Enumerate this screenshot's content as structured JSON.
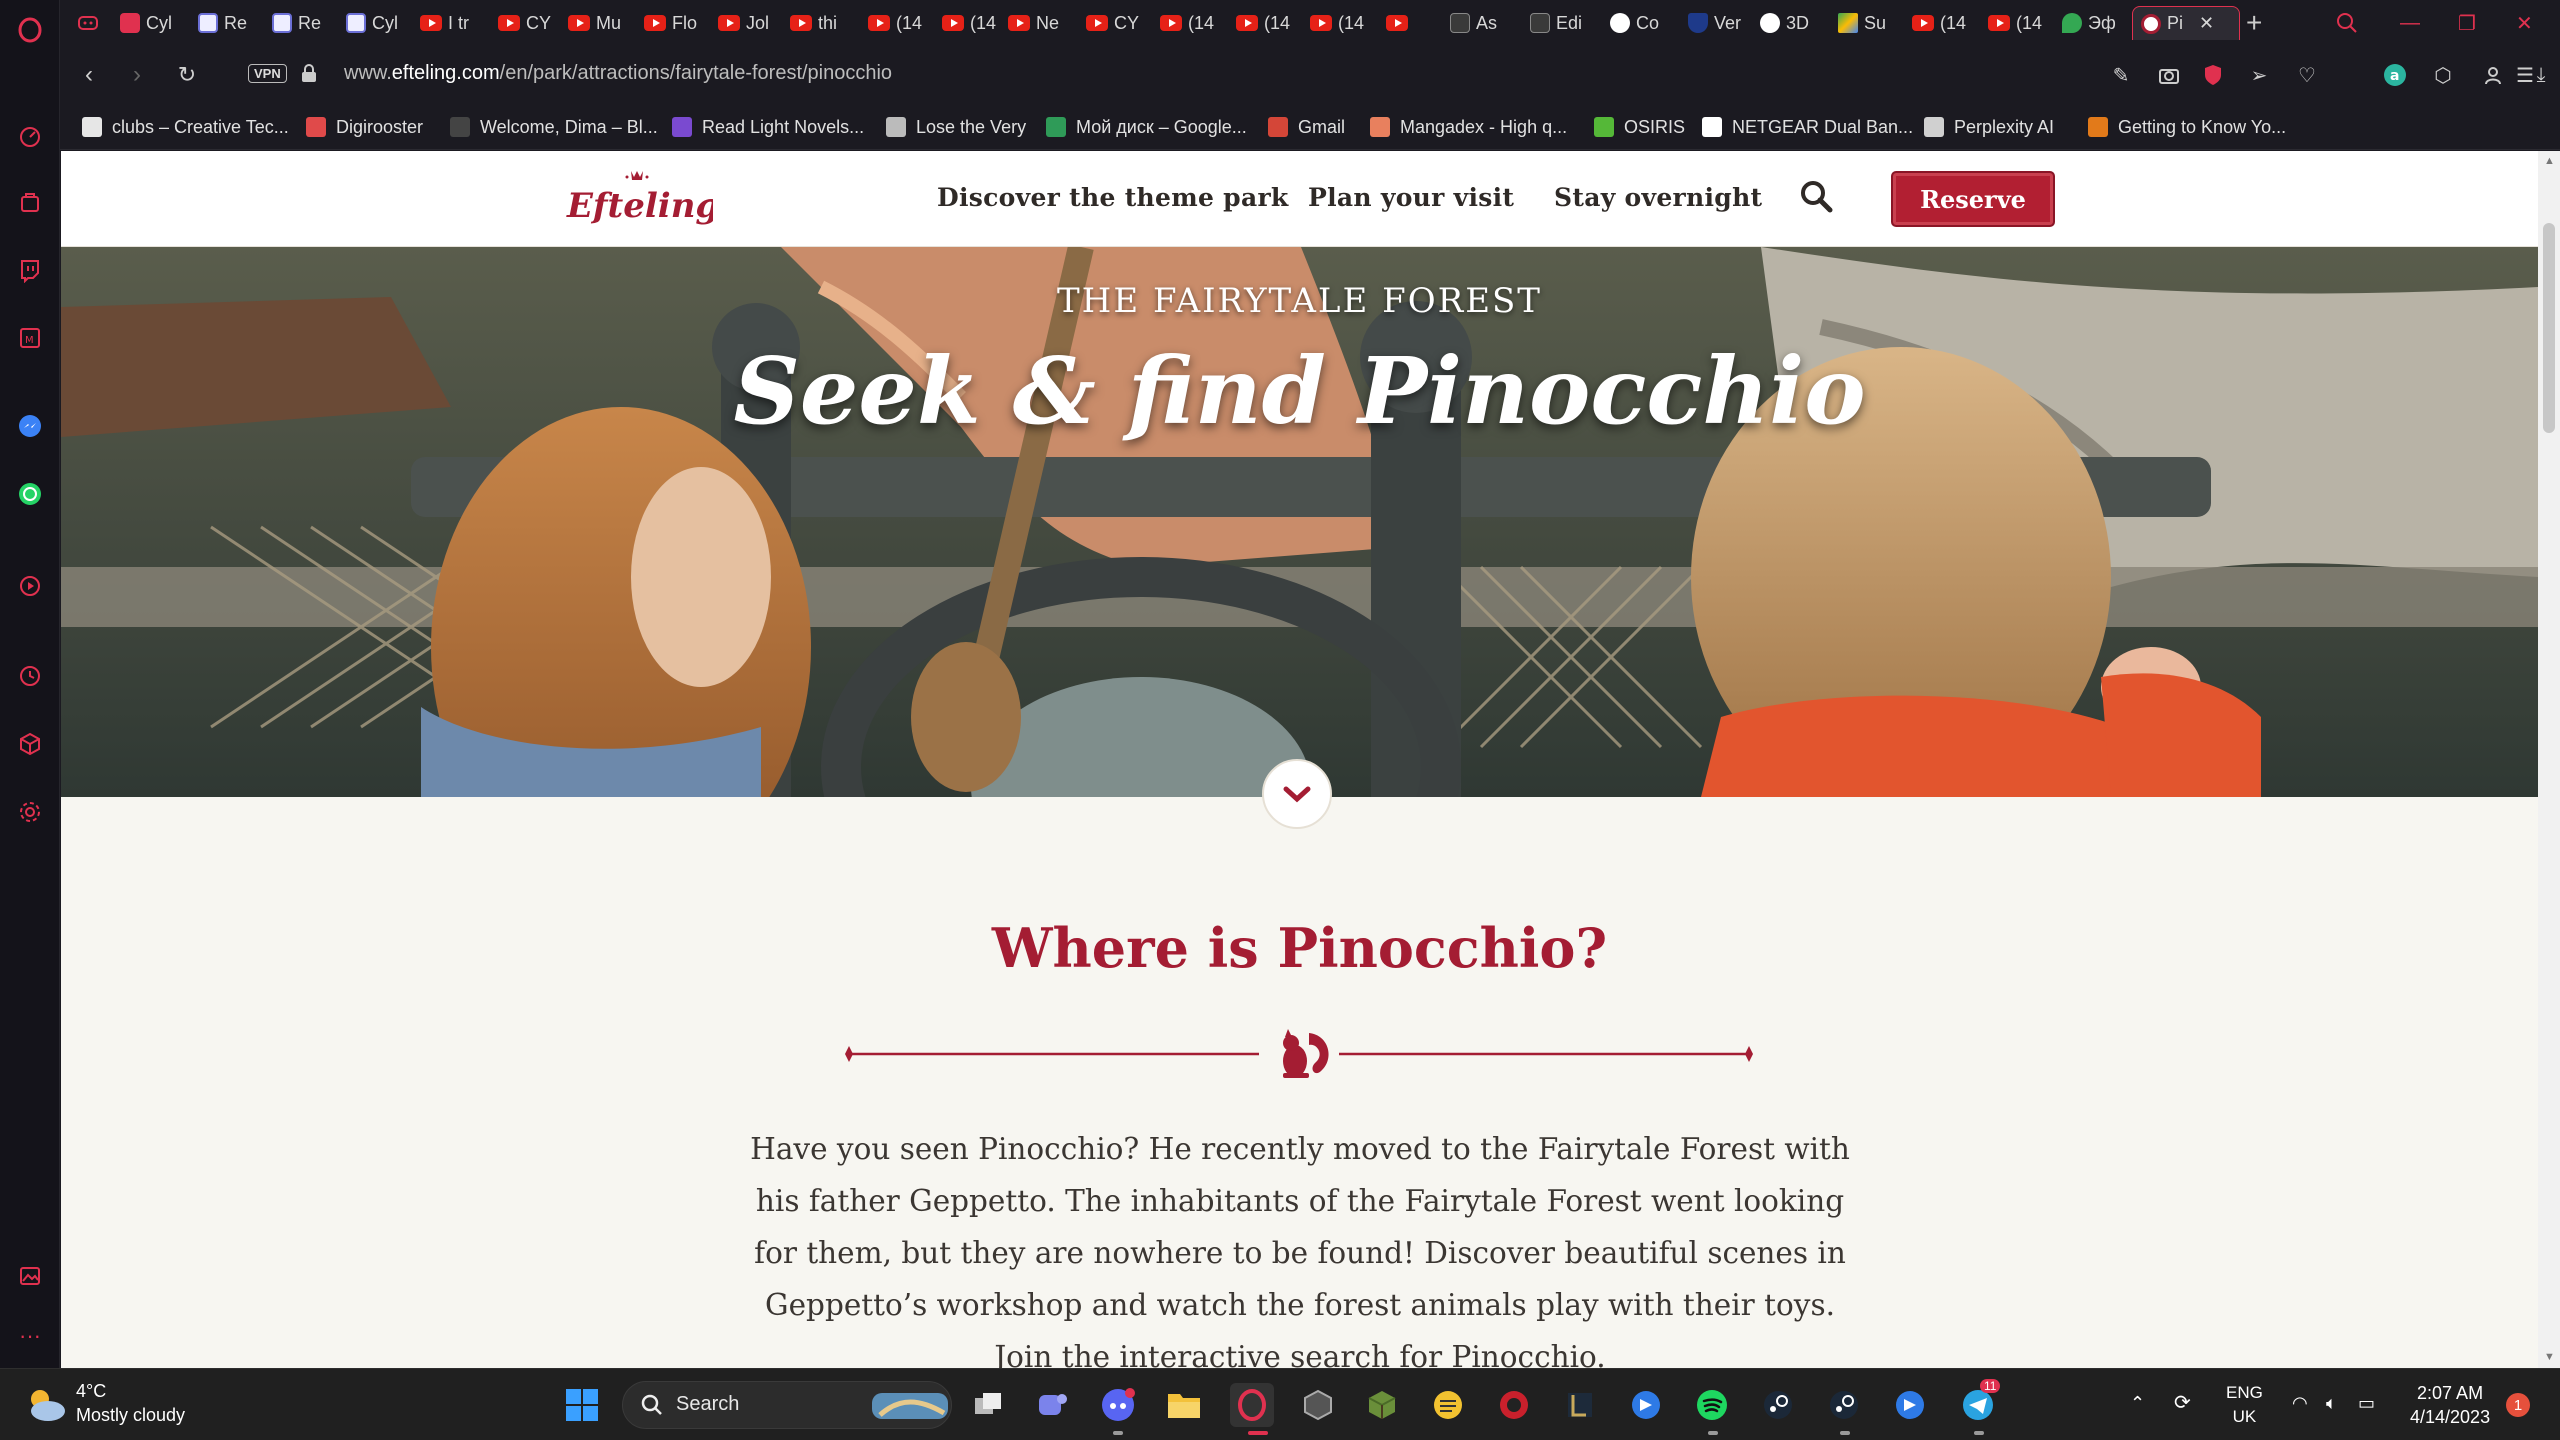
{
  "browser": {
    "tabs": [
      {
        "label": "Cyl",
        "icon": "red-link-icon"
      },
      {
        "label": "Re",
        "icon": "kv-icon"
      },
      {
        "label": "Re",
        "icon": "kv-icon"
      },
      {
        "label": "Cyl",
        "icon": "kv-icon"
      },
      {
        "label": "I tr",
        "icon": "youtube-icon"
      },
      {
        "label": "CY",
        "icon": "youtube-icon"
      },
      {
        "label": "Mu",
        "icon": "youtube-icon"
      },
      {
        "label": "Flo",
        "icon": "youtube-icon"
      },
      {
        "label": "Jol",
        "icon": "youtube-icon"
      },
      {
        "label": "thi",
        "icon": "youtube-icon"
      },
      {
        "label": "(14",
        "icon": "youtube-icon"
      },
      {
        "label": "(14",
        "icon": "youtube-icon"
      },
      {
        "label": "Ne",
        "icon": "youtube-icon"
      },
      {
        "label": "CY",
        "icon": "youtube-icon"
      },
      {
        "label": "(14",
        "icon": "youtube-icon"
      },
      {
        "label": "(14",
        "icon": "youtube-icon"
      },
      {
        "label": "(14",
        "icon": "youtube-icon"
      },
      {
        "label": "",
        "icon": "youtube-icon"
      },
      {
        "label": "As",
        "icon": "bb-icon"
      },
      {
        "label": "Edi",
        "icon": "bb-icon"
      },
      {
        "label": "Co",
        "icon": "globe-icon"
      },
      {
        "label": "Ver",
        "icon": "shield-icon"
      },
      {
        "label": "3D",
        "icon": "github-icon"
      },
      {
        "label": "Su",
        "icon": "drive-icon"
      },
      {
        "label": "(14",
        "icon": "youtube-icon"
      },
      {
        "label": "(14",
        "icon": "youtube-icon"
      },
      {
        "label": "Эф",
        "icon": "maps-icon"
      },
      {
        "label": "Pi",
        "icon": "efteling-icon",
        "active": true
      }
    ],
    "url_prefix": "www.",
    "url_domain": "efteling.com",
    "url_path": "/en/park/attractions/fairytale-forest/pinocchio",
    "vpn_label": "VPN",
    "bookmarks": [
      {
        "label": "clubs – Creative Tec...",
        "color": "#e6e6e6"
      },
      {
        "label": "Digirooster",
        "color": "#e04a4a"
      },
      {
        "label": "Welcome, Dima – Bl...",
        "color": "#444444"
      },
      {
        "label": "Read Light Novels...",
        "color": "#7a4ad0"
      },
      {
        "label": "Lose the Very",
        "color": "#bbbbbb"
      },
      {
        "label": "Мой диск – Google...",
        "color": "#2f9b58"
      },
      {
        "label": "Gmail",
        "color": "#d44638"
      },
      {
        "label": "Mangadex - High q...",
        "color": "#e8805e"
      },
      {
        "label": "OSIRIS",
        "color": "#55b838"
      },
      {
        "label": "NETGEAR Dual Ban...",
        "color": "#ffffff"
      },
      {
        "label": "Perplexity AI",
        "color": "#d0d0d0"
      },
      {
        "label": "Getting to Know Yo...",
        "color": "#e27a1a"
      }
    ]
  },
  "site": {
    "logo_text": "Efteling",
    "nav": [
      "Discover the theme park",
      "Plan your visit",
      "Stay overnight"
    ],
    "reserve_label": "Reserve",
    "hero_eyebrow": "THE FAIRYTALE FOREST",
    "hero_title": "Seek & find Pinocchio",
    "section_title": "Where is Pinocchio?",
    "intro_text": "Have you seen Pinocchio? He recently moved to the Fairytale Forest with his father Geppetto. The inhabitants of the Fairytale Forest went looking for them, but they are nowhere to be found!  Discover beautiful scenes in Geppetto’s workshop and watch the forest animals play with their toys.  Join the interactive search for Pinocchio.",
    "colors": {
      "brand_red": "#a41d33",
      "button_red": "#b21f32",
      "background": "#f7f6f1"
    }
  },
  "taskbar": {
    "temperature": "4°C",
    "weather": "Mostly cloudy",
    "search_label": "Search",
    "language_top": "ENG",
    "language_bottom": "UK",
    "time": "2:07 AM",
    "date": "4/14/2023",
    "notifications": "1",
    "telegram_badge": "11"
  }
}
